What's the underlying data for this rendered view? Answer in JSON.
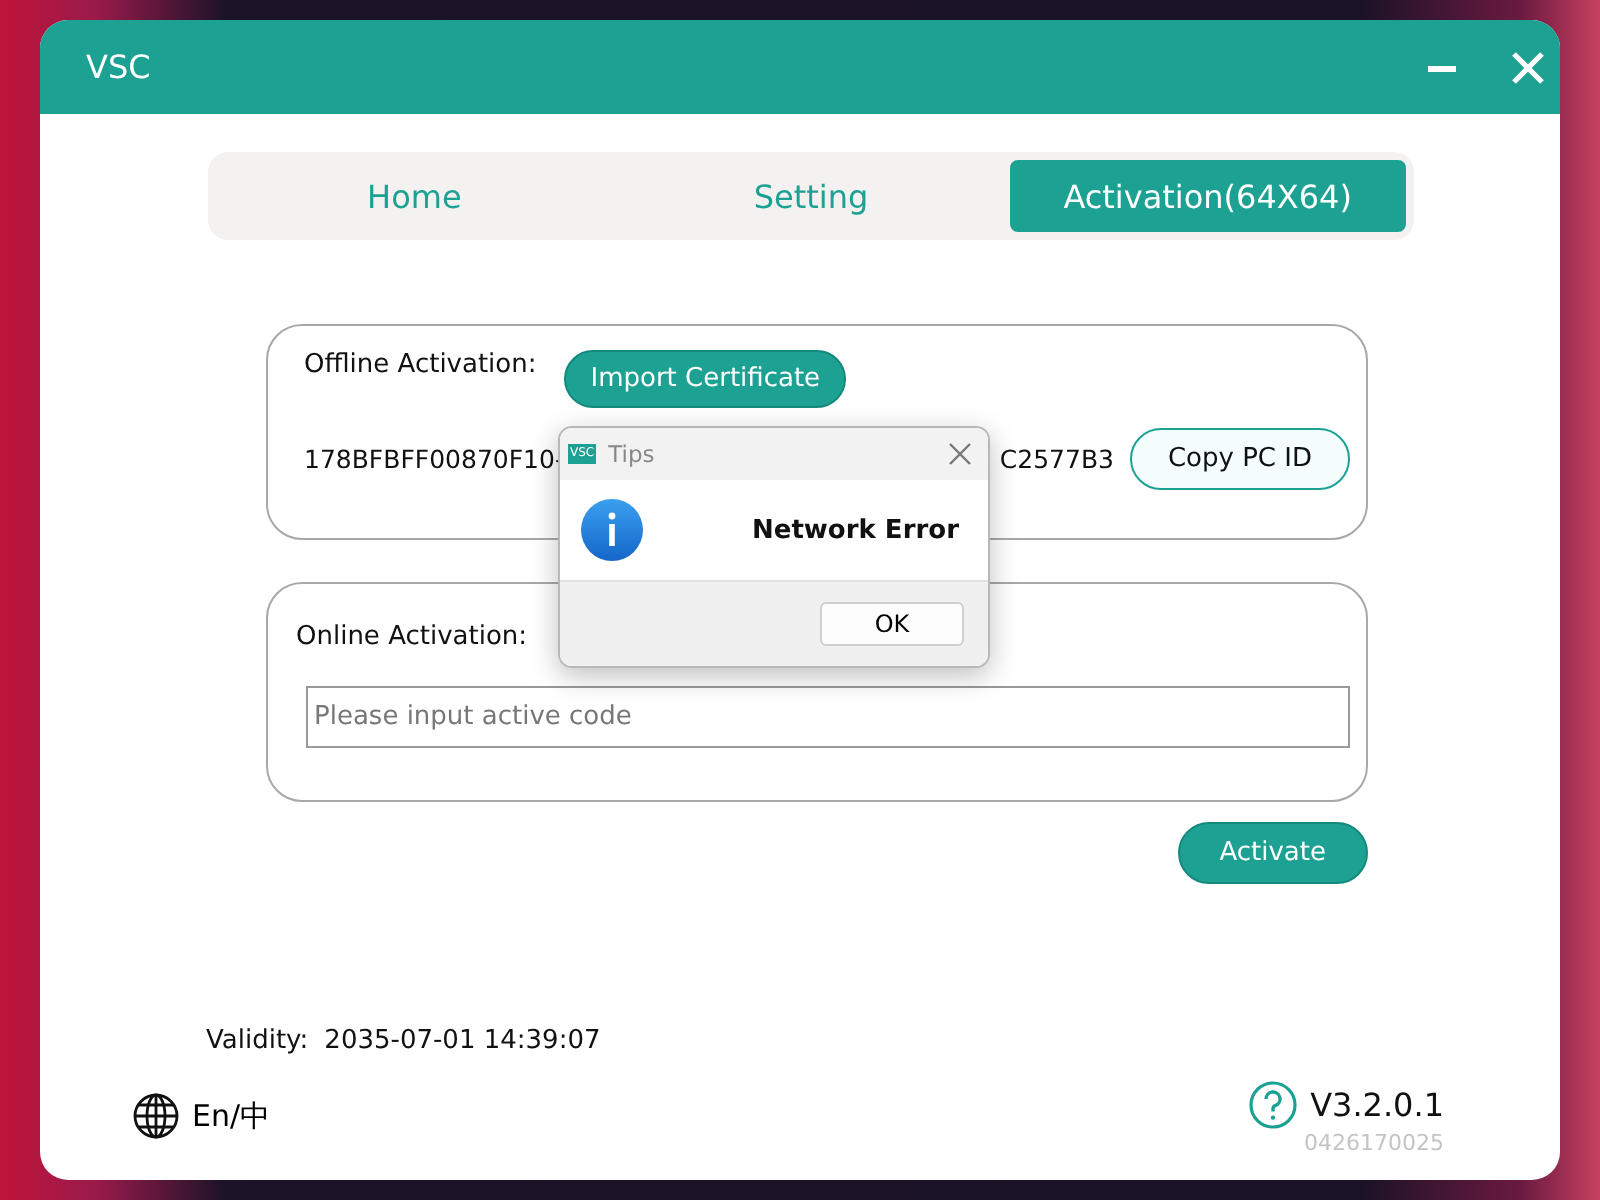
{
  "window": {
    "title": "VSC"
  },
  "tabs": [
    {
      "label": "Home",
      "selected": false
    },
    {
      "label": "Setting",
      "selected": false
    },
    {
      "label": "Activation(64X64)",
      "selected": true
    }
  ],
  "offline": {
    "label": "Offline Activation:",
    "import_button": "Import Certificate",
    "pc_id_start": "178BFBFF00870F10-",
    "pc_id_end": "C2577B3",
    "copy_button": "Copy PC ID"
  },
  "online": {
    "label": "Online Activation:",
    "code_field": {
      "placeholder": "Please input active code"
    },
    "activate_button": "Activate"
  },
  "validity": {
    "label": "Validity:",
    "value": "2035-07-01 14:39:07"
  },
  "language": "En/中",
  "version": "V3.2.0.1",
  "build": "0426170025",
  "dialog": {
    "icon_text": "VSC",
    "title": "Tips",
    "message": "Network Error",
    "button": "OK"
  }
}
